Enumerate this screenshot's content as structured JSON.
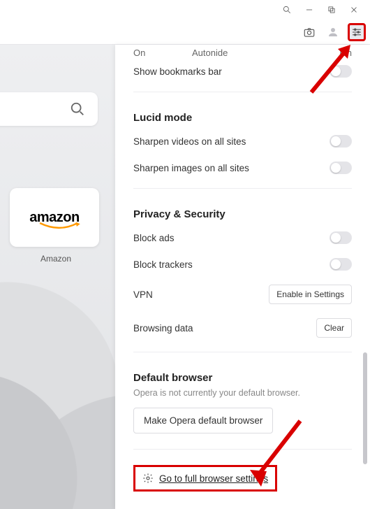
{
  "titlebar": {
    "minimize": "–",
    "maximize": "❐",
    "close": "✕"
  },
  "toolbar": {},
  "row3": {
    "c1": "On",
    "c2": "Autonide",
    "c3": "On"
  },
  "bookmarks": {
    "label": "Show bookmarks bar"
  },
  "lucid": {
    "title": "Lucid mode",
    "items": [
      {
        "label": "Sharpen videos on all sites"
      },
      {
        "label": "Sharpen images on all sites"
      }
    ]
  },
  "privacy": {
    "title": "Privacy & Security",
    "block_ads": "Block ads",
    "block_trackers": "Block trackers",
    "vpn": "VPN",
    "vpn_btn": "Enable in Settings",
    "browsing_data": "Browsing data",
    "clear": "Clear"
  },
  "defaultb": {
    "title": "Default browser",
    "subtitle": "Opera is not currently your default browser.",
    "btn": "Make Opera default browser"
  },
  "footer": {
    "label": "Go to full browser settings"
  },
  "tile": {
    "brand": "amazon",
    "label": "Amazon"
  }
}
